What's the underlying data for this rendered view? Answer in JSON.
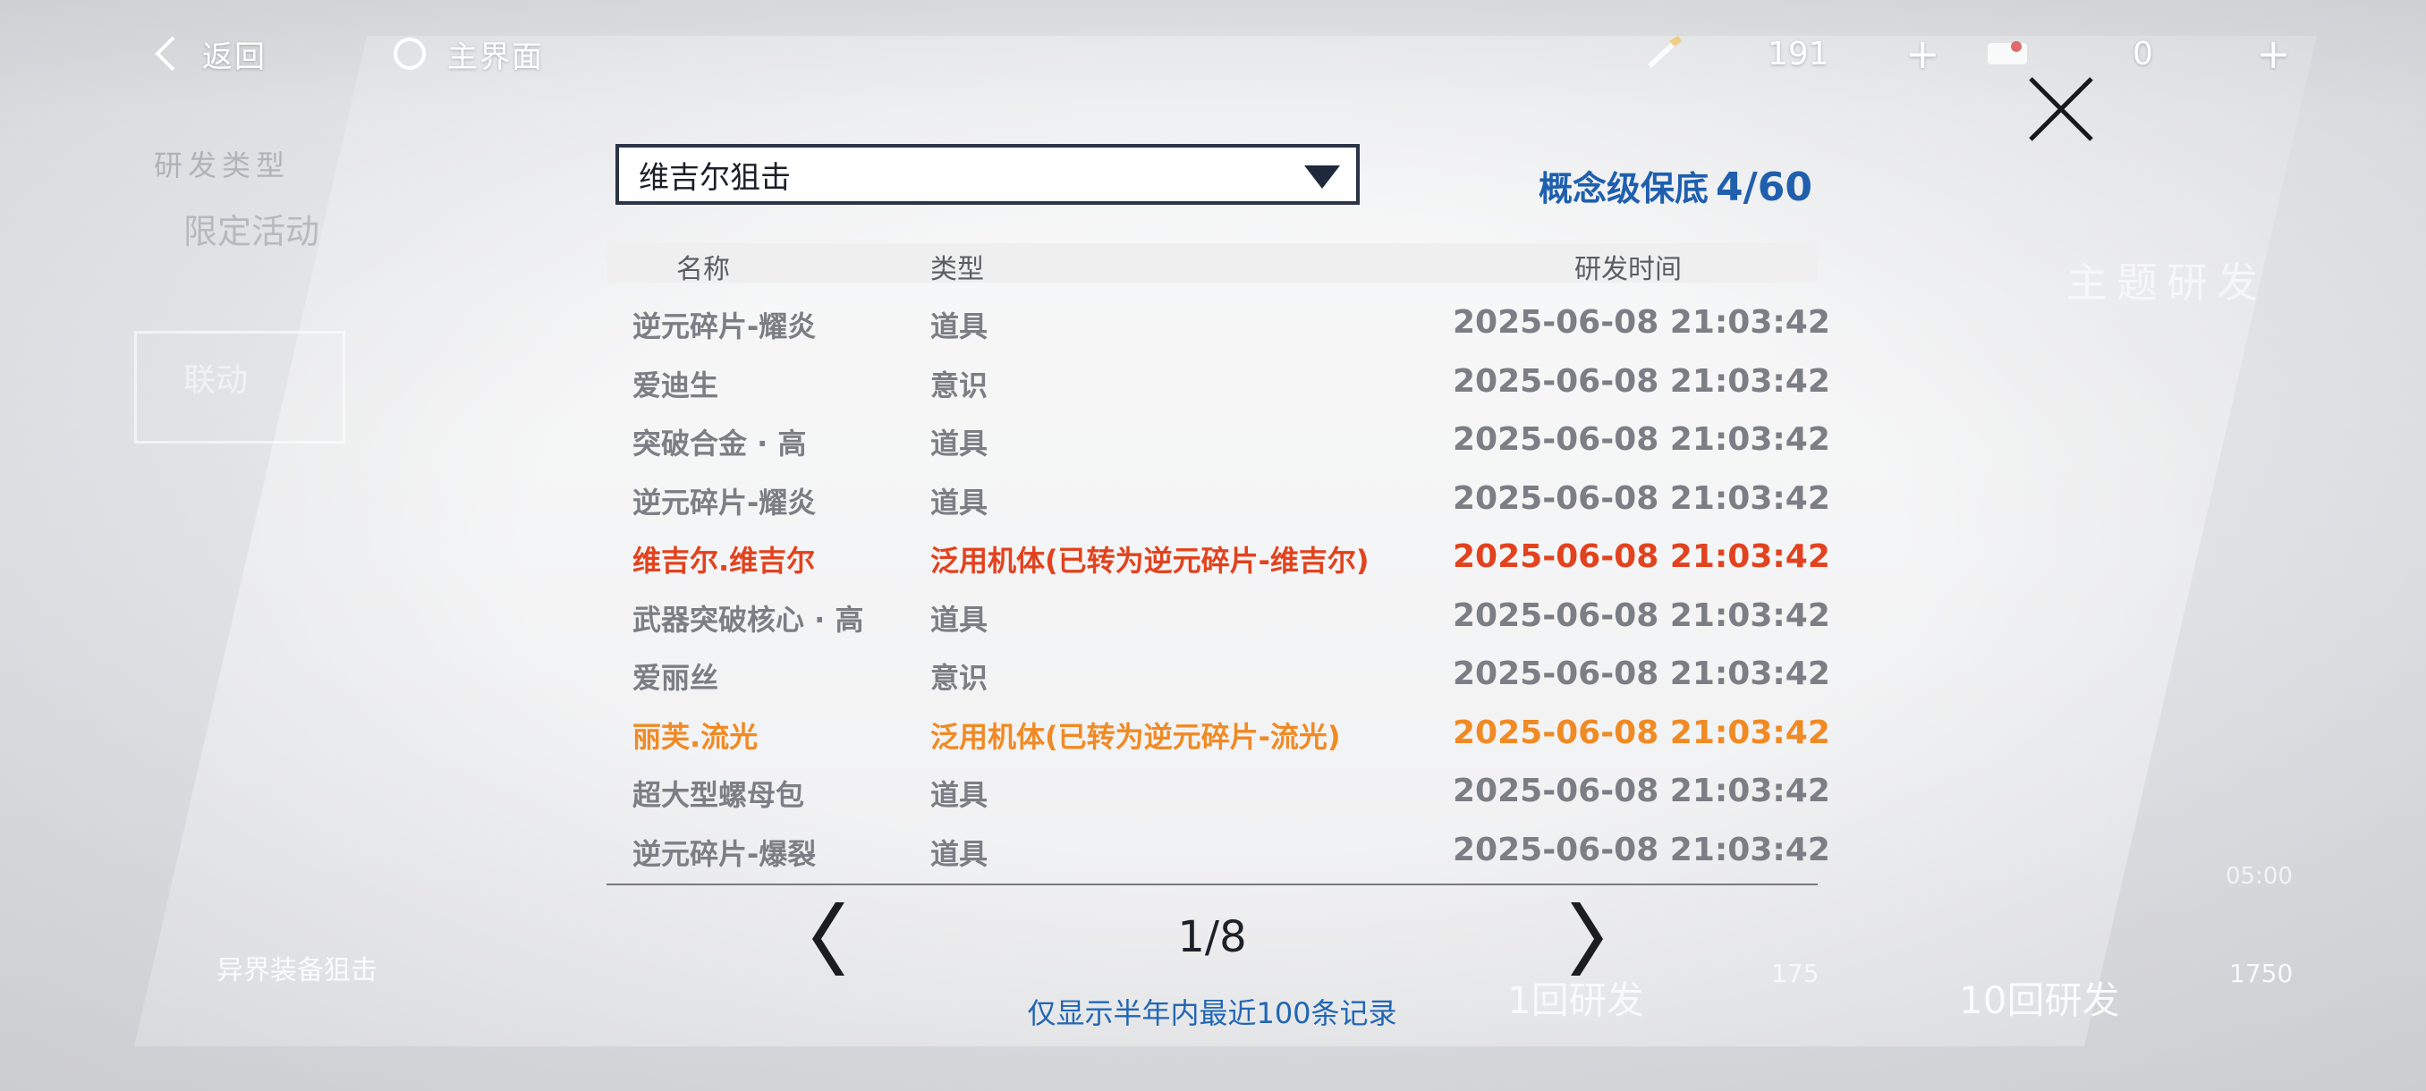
{
  "nav": {
    "back_label": "返回",
    "home_label": "主界面"
  },
  "resources": [
    {
      "icon": "research-chip-icon",
      "value": "191"
    },
    {
      "icon": "ticket-icon",
      "value": "0"
    }
  ],
  "modal": {
    "dropdown_value": "维吉尔狙击",
    "pity_label": "概念级保底",
    "pity_value": "4/60",
    "columns": [
      "名称",
      "类型",
      "研发时间"
    ],
    "rows": [
      {
        "name": "逆元碎片-耀炎",
        "type": "道具",
        "time": "2025-06-08 21:03:42",
        "tone": "normal"
      },
      {
        "name": "爱迪生",
        "type": "意识",
        "time": "2025-06-08 21:03:42",
        "tone": "normal"
      },
      {
        "name": "突破合金 · 高",
        "type": "道具",
        "time": "2025-06-08 21:03:42",
        "tone": "normal"
      },
      {
        "name": "逆元碎片-耀炎",
        "type": "道具",
        "time": "2025-06-08 21:03:42",
        "tone": "normal"
      },
      {
        "name": "维吉尔.维吉尔",
        "type": "泛用机体(已转为逆元碎片-维吉尔)",
        "time": "2025-06-08 21:03:42",
        "tone": "red"
      },
      {
        "name": "武器突破核心 · 高",
        "type": "道具",
        "time": "2025-06-08 21:03:42",
        "tone": "normal"
      },
      {
        "name": "爱丽丝",
        "type": "意识",
        "time": "2025-06-08 21:03:42",
        "tone": "normal"
      },
      {
        "name": "丽芙.流光",
        "type": "泛用机体(已转为逆元碎片-流光)",
        "time": "2025-06-08 21:03:42",
        "tone": "orange"
      },
      {
        "name": "超大型螺母包",
        "type": "道具",
        "time": "2025-06-08 21:03:42",
        "tone": "normal"
      },
      {
        "name": "逆元碎片-爆裂",
        "type": "道具",
        "time": "2025-06-08 21:03:42",
        "tone": "normal"
      }
    ],
    "page": "1/8",
    "note": "仅显示半年内最近100条记录"
  },
  "background": {
    "research_type_label": "研发类型",
    "limited_event": "限定活动",
    "linkage": "联动",
    "theme_research": "主题研发",
    "gear_research": "异界装备狙击",
    "research_1": "1回研发",
    "research_10": "10回研发",
    "cost_1": "175",
    "cost_10": "1750",
    "time": "05:00"
  },
  "colors": {
    "accent_blue": "#1f5fae",
    "red_row": "#e2421e",
    "orange_row": "#f08a24"
  }
}
